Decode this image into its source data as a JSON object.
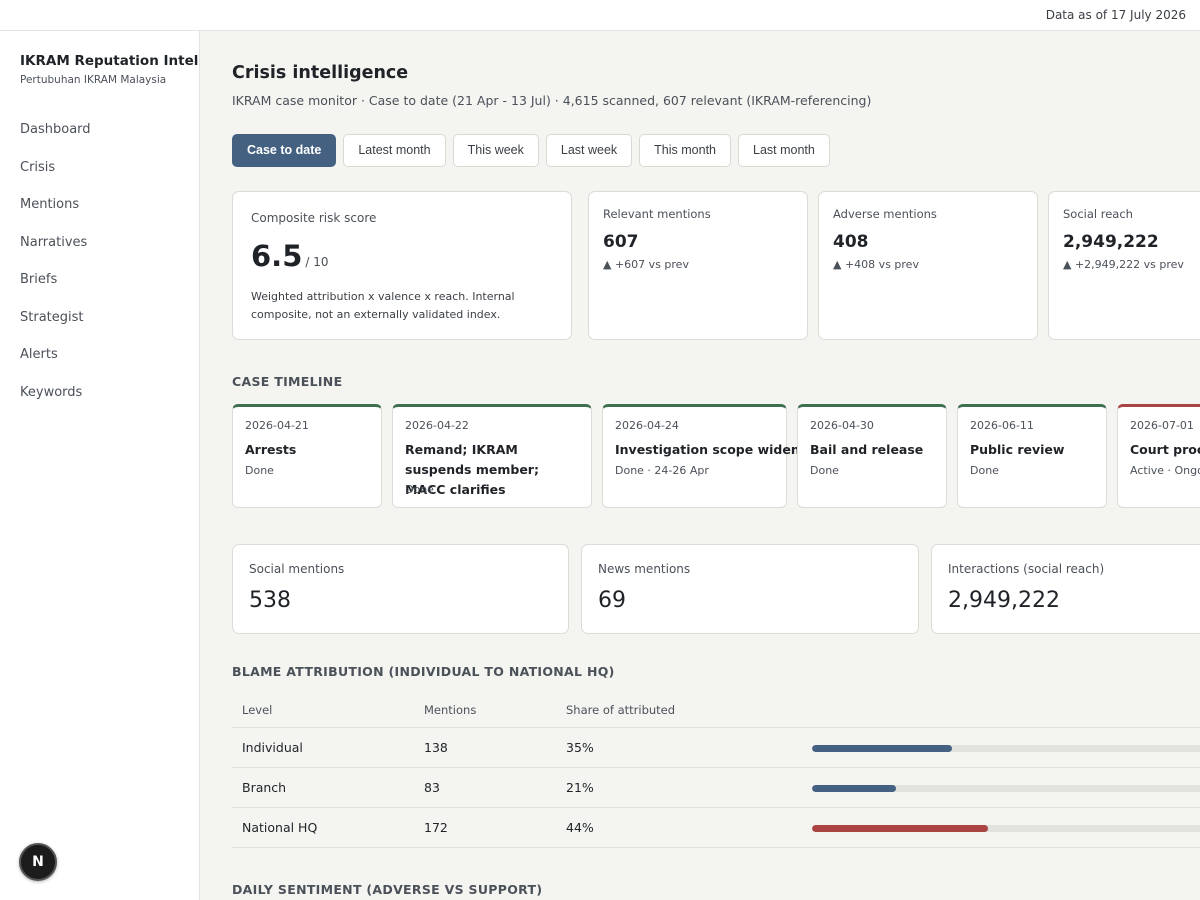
{
  "topbar": {
    "as_of": "Data as of 17 July 2026"
  },
  "sidebar": {
    "app_name": "IKRAM Reputation Intel",
    "org_name": "Pertubuhan IKRAM Malaysia",
    "items": [
      {
        "label": "Dashboard"
      },
      {
        "label": "Crisis"
      },
      {
        "label": "Mentions"
      },
      {
        "label": "Narratives"
      },
      {
        "label": "Briefs"
      },
      {
        "label": "Strategist"
      },
      {
        "label": "Alerts"
      },
      {
        "label": "Keywords"
      }
    ],
    "badge": "N"
  },
  "page": {
    "title": "Crisis intelligence",
    "subtitle": "IKRAM case monitor · Case to date (21 Apr - 13 Jul) · 4,615 scanned, 607 relevant (IKRAM-referencing)"
  },
  "periods": [
    {
      "label": "Case to date",
      "active": true
    },
    {
      "label": "Latest month",
      "active": false
    },
    {
      "label": "This week",
      "active": false
    },
    {
      "label": "Last week",
      "active": false
    },
    {
      "label": "This month",
      "active": false
    },
    {
      "label": "Last month",
      "active": false
    }
  ],
  "risk": {
    "label": "Composite risk score",
    "score": "6.5",
    "denominator": "/ 10",
    "description": "Weighted attribution x valence x reach. Internal composite, not an externally validated index."
  },
  "kpis": [
    {
      "label": "Relevant mentions",
      "value": "607",
      "delta": "+607 vs prev",
      "delta_icon": "triangle-up-icon"
    },
    {
      "label": "Adverse mentions",
      "value": "408",
      "delta": "+408 vs prev",
      "delta_icon": "triangle-up-icon"
    },
    {
      "label": "Social reach",
      "value": "2,949,222",
      "delta": "+2,949,222 vs prev",
      "delta_icon": "triangle-up-icon"
    }
  ],
  "timeline": {
    "heading": "CASE TIMELINE",
    "events": [
      {
        "date": "2026-04-21",
        "title": "Arrests",
        "status": "Done"
      },
      {
        "date": "2026-04-22",
        "title": "Remand; IKRAM suspends member; MACC clarifies",
        "status": "Done"
      },
      {
        "date": "2026-04-24",
        "title": "Investigation scope widens",
        "status": "Done · 24-26 Apr"
      },
      {
        "date": "2026-04-30",
        "title": "Bail and release",
        "status": "Done"
      },
      {
        "date": "2026-06-11",
        "title": "Public review",
        "status": "Done"
      },
      {
        "date": "2026-07-01",
        "title": "Court proceedings",
        "status": "Active · Ongoing"
      }
    ]
  },
  "mentions": [
    {
      "label": "Social mentions",
      "value": "538"
    },
    {
      "label": "News mentions",
      "value": "69"
    },
    {
      "label": "Interactions (social reach)",
      "value": "2,949,222"
    }
  ],
  "blame": {
    "heading": "BLAME ATTRIBUTION (INDIVIDUAL TO NATIONAL HQ)",
    "columns": [
      "Level",
      "Mentions",
      "Share of attributed"
    ],
    "rows": [
      {
        "level": "Individual",
        "mentions": "138",
        "share": "35%",
        "share_value": 0.35,
        "color": "#456181"
      },
      {
        "level": "Branch",
        "mentions": "83",
        "share": "21%",
        "share_value": 0.21,
        "color": "#456181"
      },
      {
        "level": "National HQ",
        "mentions": "172",
        "share": "44%",
        "share_value": 0.44,
        "color": "#a94442"
      }
    ]
  },
  "sentiment": {
    "heading": "DAILY SENTIMENT (ADVERSE VS SUPPORT)"
  },
  "colors": {
    "accent": "#456181",
    "done": "#3f7150",
    "active": "#a94442",
    "track": "#e1e1de"
  }
}
